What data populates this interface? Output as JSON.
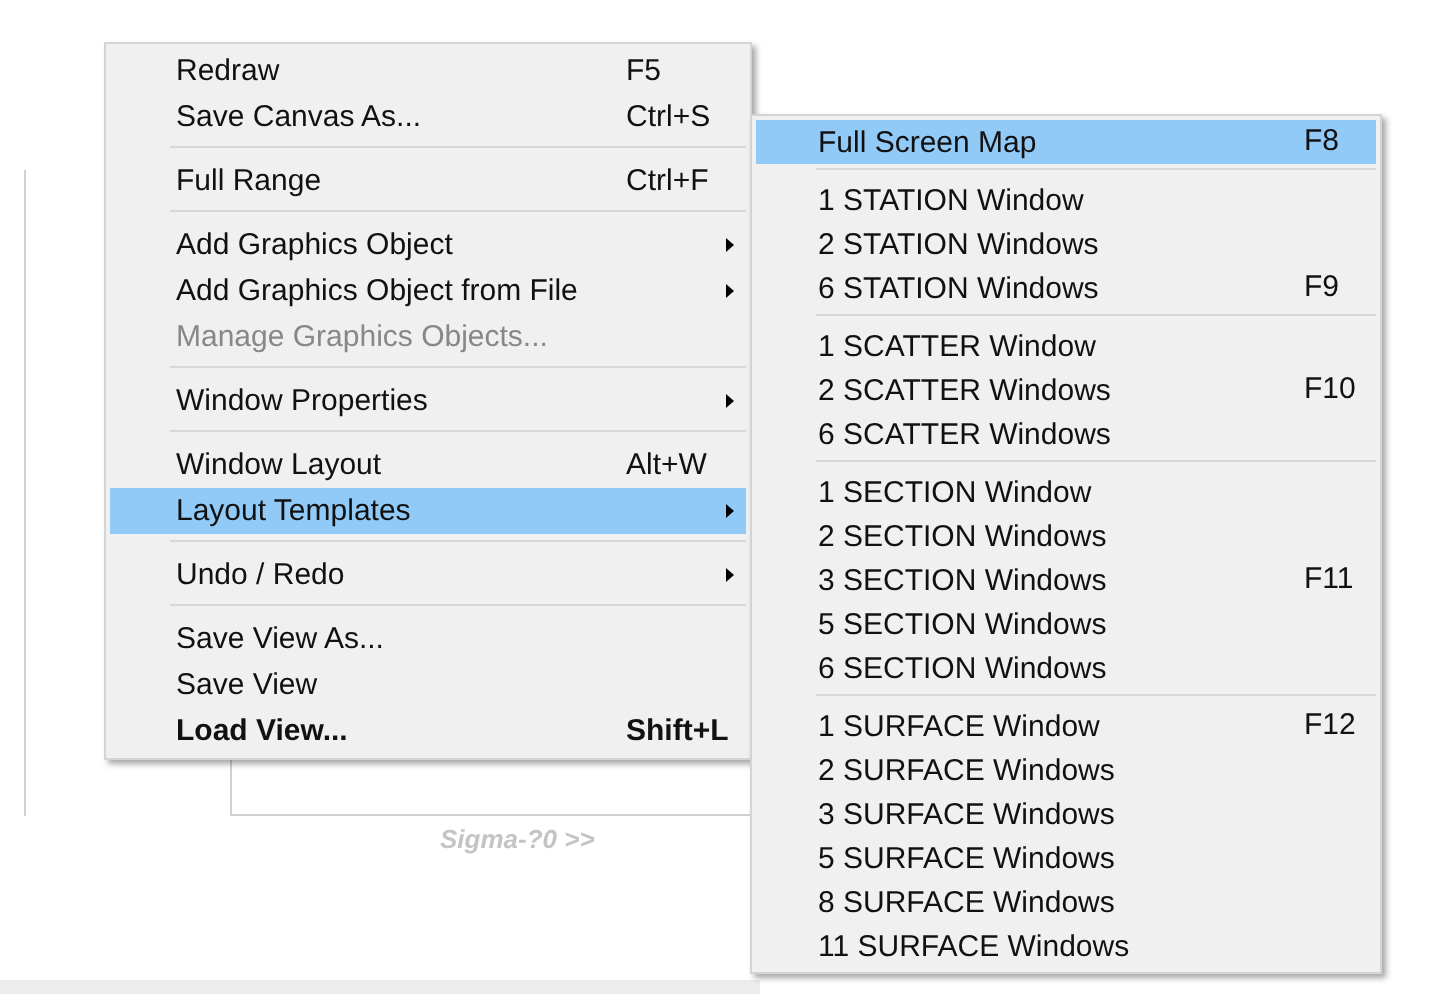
{
  "background": {
    "label": "Sigma-?0 >>"
  },
  "context_menu": {
    "groups": [
      [
        {
          "label": "Redraw",
          "shortcut": "F5",
          "submenu": false,
          "disabled": false,
          "default": false,
          "selected": false
        },
        {
          "label": "Save Canvas As...",
          "shortcut": "Ctrl+S",
          "submenu": false,
          "disabled": false,
          "default": false,
          "selected": false
        }
      ],
      [
        {
          "label": "Full Range",
          "shortcut": "Ctrl+F",
          "submenu": false,
          "disabled": false,
          "default": false,
          "selected": false
        }
      ],
      [
        {
          "label": "Add Graphics Object",
          "submenu": true,
          "disabled": false,
          "default": false,
          "selected": false
        },
        {
          "label": "Add Graphics Object from File",
          "submenu": true,
          "disabled": false,
          "default": false,
          "selected": false
        },
        {
          "label": "Manage Graphics Objects...",
          "submenu": false,
          "disabled": true,
          "default": false,
          "selected": false
        }
      ],
      [
        {
          "label": "Window Properties",
          "submenu": true,
          "disabled": false,
          "default": false,
          "selected": false
        }
      ],
      [
        {
          "label": "Window Layout",
          "shortcut": "Alt+W",
          "submenu": false,
          "disabled": false,
          "default": false,
          "selected": false
        },
        {
          "label": "Layout Templates",
          "submenu": true,
          "disabled": false,
          "default": false,
          "selected": true
        }
      ],
      [
        {
          "label": "Undo / Redo",
          "submenu": true,
          "disabled": false,
          "default": false,
          "selected": false
        }
      ],
      [
        {
          "label": "Save View As...",
          "submenu": false,
          "disabled": false,
          "default": false,
          "selected": false
        },
        {
          "label": "Save View",
          "submenu": false,
          "disabled": false,
          "default": false,
          "selected": false
        },
        {
          "label": "Load View...",
          "shortcut": "Shift+L",
          "submenu": false,
          "disabled": false,
          "default": true,
          "selected": false
        }
      ]
    ]
  },
  "submenu": {
    "groups": [
      [
        {
          "label": "Full Screen Map",
          "shortcut": "F8",
          "selected": true
        }
      ],
      [
        {
          "label": "1 STATION Window",
          "selected": false
        },
        {
          "label": "2 STATION Windows",
          "selected": false
        },
        {
          "label": "6 STATION Windows",
          "shortcut": "F9",
          "selected": false
        }
      ],
      [
        {
          "label": "1 SCATTER Window",
          "selected": false
        },
        {
          "label": "2 SCATTER Windows",
          "shortcut": "F10",
          "selected": false
        },
        {
          "label": "6 SCATTER Windows",
          "selected": false
        }
      ],
      [
        {
          "label": "1 SECTION Window",
          "selected": false
        },
        {
          "label": "2 SECTION Windows",
          "selected": false
        },
        {
          "label": "3 SECTION Windows",
          "shortcut": "F11",
          "selected": false
        },
        {
          "label": "5 SECTION Windows",
          "selected": false
        },
        {
          "label": "6 SECTION Windows",
          "selected": false
        }
      ],
      [
        {
          "label": "1 SURFACE Window",
          "shortcut": "F12",
          "selected": false
        },
        {
          "label": "2 SURFACE Windows",
          "selected": false
        },
        {
          "label": "3 SURFACE Windows",
          "selected": false
        },
        {
          "label": "5 SURFACE Windows",
          "selected": false
        },
        {
          "label": "8 SURFACE Windows",
          "selected": false
        },
        {
          "label": "11 SURFACE Windows",
          "selected": false
        }
      ]
    ]
  }
}
